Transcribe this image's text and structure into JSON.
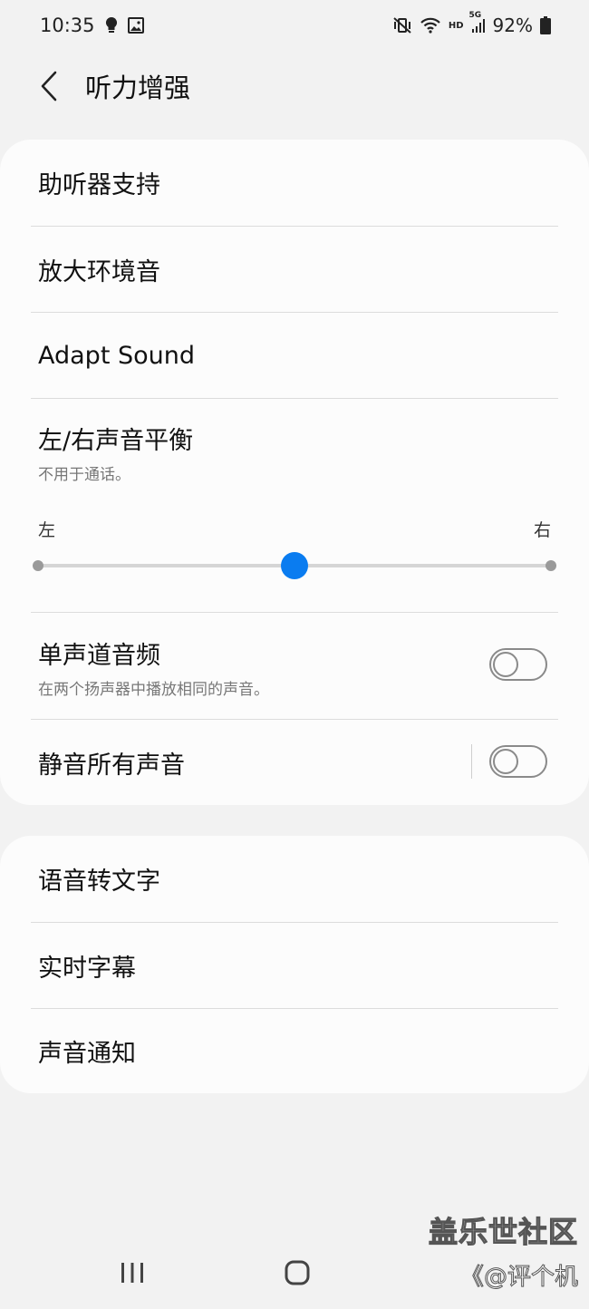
{
  "status_bar": {
    "time": "10:35",
    "left_icons": [
      "lightbulb-icon",
      "image-icon"
    ],
    "right_icons": [
      "mute-vibrate-icon",
      "wifi-icon",
      "hd-icon",
      "5g-signal-icon",
      "battery-icon"
    ],
    "hd_label": "HD",
    "network_label": "5G",
    "battery": "92%"
  },
  "header": {
    "title": "听力增强"
  },
  "card1": {
    "hearing_aid": "助听器支持",
    "amplify_ambient": "放大环境音",
    "adapt_sound": "Adapt Sound",
    "balance": {
      "label": "左/右声音平衡",
      "sub": "不用于通话。",
      "left_label": "左",
      "right_label": "右",
      "value": 0.5
    },
    "mono_audio": {
      "label": "单声道音频",
      "sub": "在两个扬声器中播放相同的声音。",
      "enabled": false
    },
    "mute_all": {
      "label": "静音所有声音",
      "enabled": false
    }
  },
  "card2": {
    "speech_to_text": "语音转文字",
    "live_caption": "实时字幕",
    "sound_notifications": "声音通知"
  },
  "nav": {
    "icons": [
      "recent-apps-icon",
      "home-icon"
    ]
  },
  "watermark": {
    "line1": "盖乐世社区",
    "line2": "《@评个机"
  },
  "colors": {
    "accent": "#0a7cf0",
    "background": "#f2f2f2",
    "card": "#fcfcfc"
  }
}
